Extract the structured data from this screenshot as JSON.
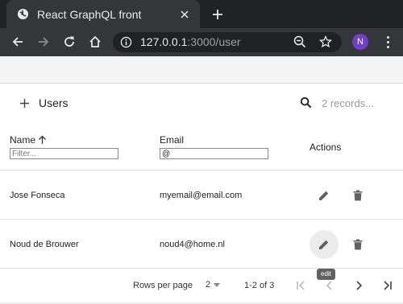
{
  "browser": {
    "tab_title": "React GraphQL front",
    "url_host": "127.0.0.1",
    "url_path": ":3000/user",
    "profile_initial": "N"
  },
  "toolbar": {
    "title": "Users",
    "search_placeholder": "2 records..."
  },
  "columns": {
    "name": {
      "label": "Name",
      "filter_placeholder": "Filter...",
      "filter_value": ""
    },
    "email": {
      "label": "Email",
      "filter_value": "@"
    },
    "actions": {
      "label": "Actions"
    }
  },
  "rows": [
    {
      "name": "Jose Fonseca",
      "email": "myemail@email.com"
    },
    {
      "name": "Noud de Brouwer",
      "email": "noud4@home.nl"
    }
  ],
  "tooltip": "edit",
  "pagination": {
    "rows_per_page_label": "Rows per page",
    "rows_per_page_value": "2",
    "range": "1-2 of 3"
  },
  "icons": {
    "favicon": "globe-icon",
    "new_tab": "plus-icon",
    "back": "arrow-left-icon",
    "forward": "arrow-right-icon",
    "reload": "reload-icon",
    "home": "home-icon",
    "site_info": "info-icon",
    "zoom": "zoom-out-icon",
    "bookmark": "star-icon",
    "add": "plus-icon",
    "search": "search-icon",
    "sort": "arrow-up-icon",
    "edit": "pencil-icon",
    "delete": "trash-icon"
  }
}
